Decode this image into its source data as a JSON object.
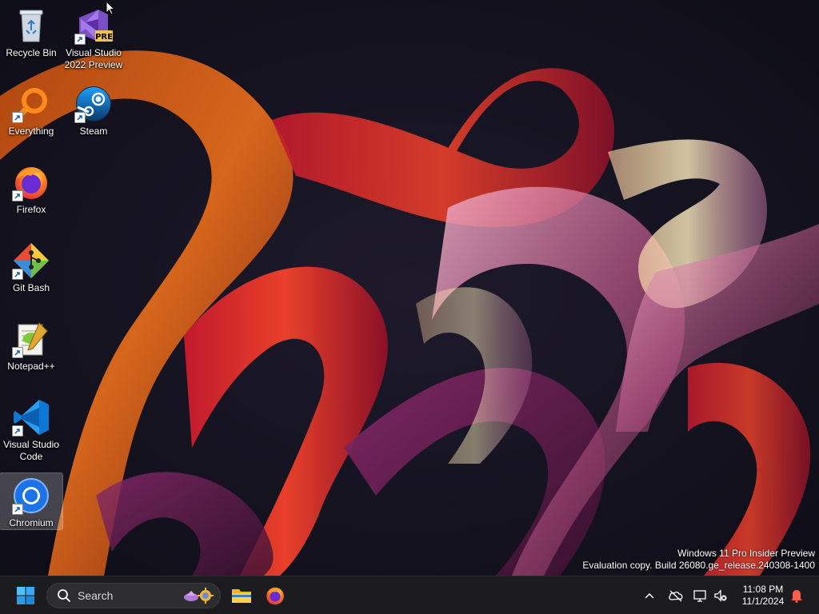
{
  "desktop": {
    "icons": [
      {
        "label": "Recycle Bin",
        "icon": "recycle-bin-icon"
      },
      {
        "label": "Visual Studio\n2022 Preview",
        "icon": "visual-studio-icon",
        "badge": "PRE"
      },
      {
        "label": "Everything",
        "icon": "everything-search-icon"
      },
      {
        "label": "Steam",
        "icon": "steam-icon"
      },
      {
        "label": "Firefox",
        "icon": "firefox-icon"
      },
      {
        "label": "Git Bash",
        "icon": "git-bash-icon"
      },
      {
        "label": "Notepad++",
        "icon": "notepad-plus-plus-icon"
      },
      {
        "label": "Visual Studio\nCode",
        "icon": "vscode-icon"
      },
      {
        "label": "Chromium",
        "icon": "chromium-icon",
        "selected": true
      }
    ]
  },
  "watermark": {
    "line1": "Windows 11 Pro Insider Preview",
    "line2": "Evaluation copy. Build 26080.ge_release.240308-1400"
  },
  "taskbar": {
    "search_label": "Search",
    "pinned": [
      "file-explorer-icon",
      "firefox-icon"
    ],
    "clock": {
      "time": "11:08 PM",
      "date": "11/1/2024"
    }
  },
  "colors": {
    "taskbar_bg": "#1c1c1e",
    "accent": "#0078d4"
  }
}
